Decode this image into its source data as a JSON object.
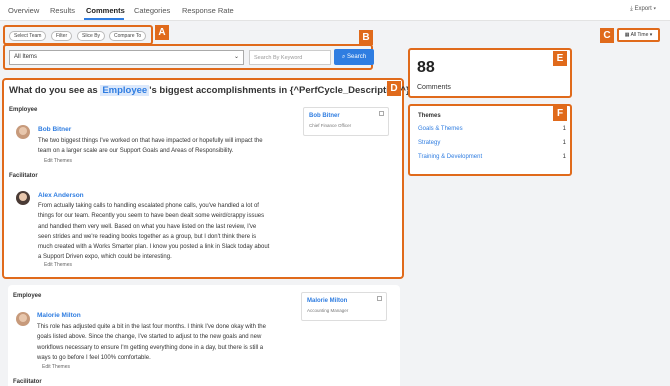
{
  "nav": {
    "tabs": [
      "Overview",
      "Results",
      "Comments",
      "Categories",
      "Response Rate"
    ],
    "export": "Export"
  },
  "filters": {
    "buttons": [
      "Select Team",
      "Filter",
      "Slice By",
      "Compare To"
    ]
  },
  "search": {
    "select_value": "All Items",
    "placeholder": "Search By Keyword",
    "button": "Search"
  },
  "date_range": "All Time",
  "badges": [
    "A",
    "B",
    "C",
    "D",
    "E",
    "F"
  ],
  "question": {
    "prefix": "What do you see as",
    "highlight": "Employee",
    "suffix": "'s biggest accomplishments in {^PerfCycle_Description^}?"
  },
  "responses": [
    {
      "section": "Employee",
      "name": "Bob Bitner",
      "text_lines": [
        "The two biggest things I've worked on that have impacted or hopefully will impact the",
        "team on a larger scale are our Support Goals and Areas of Responsibility."
      ],
      "edit": "Edit Themes",
      "profile": {
        "name": "Bob Bitner",
        "role": "Chief Finance Officer"
      }
    },
    {
      "section": "Facilitator",
      "name": "Alex Anderson",
      "text_lines": [
        "From actually taking calls to handling escalated phone calls, you've handled a lot of",
        "things for our team. Recently you seem to have been dealt some weird/crappy issues",
        "and handled them very well. Based on what you have listed on the last review, I've",
        "seen strides and we're reading books together as a group, but I don't think there is",
        "much created with a Works Smarter plan. I know you posted a link in Slack today about",
        "a Support Driven expo, which could be interesting."
      ],
      "edit": "Edit Themes"
    },
    {
      "section": "Employee",
      "name": "Malorie Milton",
      "text_lines": [
        "This role has adjusted quite a bit in the last four months. I think I've done okay with the",
        "goals listed above. Since the change, I've started to adjust to the new goals and new",
        "workflows necessary to ensure I'm getting everything done in a day, but there is still a",
        "ways to go before I feel 100% comfortable."
      ],
      "edit": "Edit Themes",
      "profile": {
        "name": "Malorie Milton",
        "role": "Accounting Manager"
      }
    },
    {
      "section": "Facilitator"
    }
  ],
  "summary": {
    "count": "88",
    "label": "Comments"
  },
  "themes": {
    "title": "Themes",
    "items": [
      {
        "name": "Goals & Themes",
        "count": "1"
      },
      {
        "name": "Strategy",
        "count": "1"
      },
      {
        "name": "Training & Development",
        "count": "1"
      }
    ]
  },
  "colors": {
    "accent": "#2f7de1",
    "annotation": "#e06a1b"
  }
}
